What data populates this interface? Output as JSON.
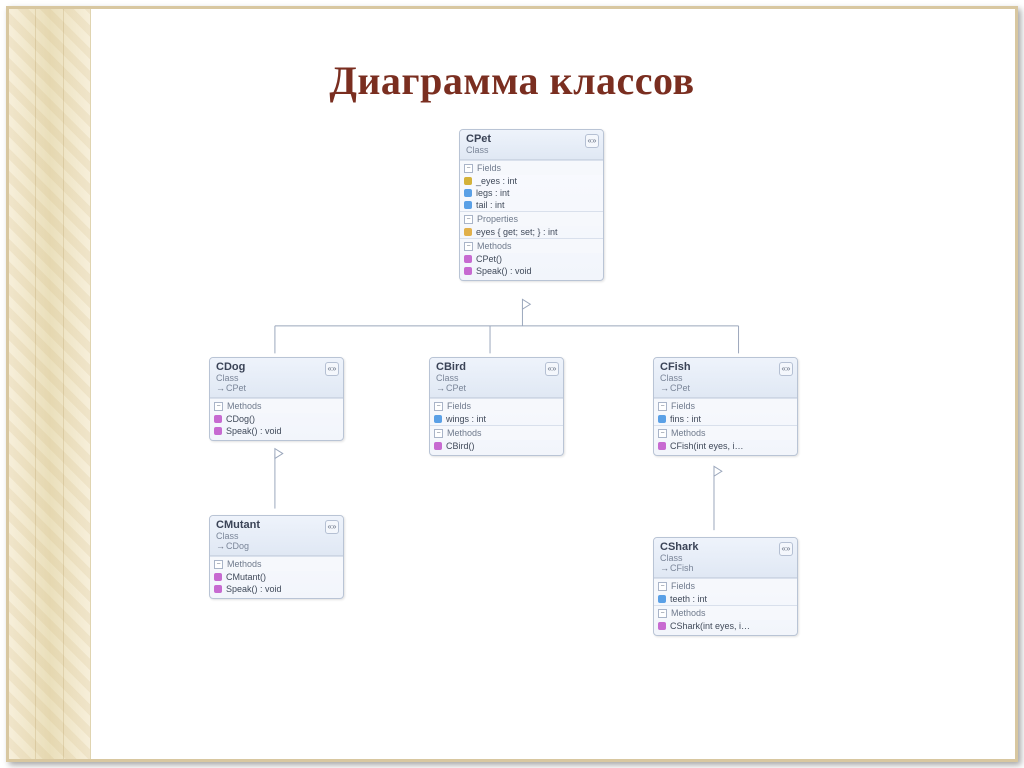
{
  "title": "Диаграмма классов",
  "labels": {
    "class": "Class",
    "fields": "Fields",
    "properties": "Properties",
    "methods": "Methods",
    "chevrons": "«»"
  },
  "classes": {
    "cpet": {
      "name": "CPet",
      "kind": "Class",
      "fields": [
        "_eyes : int",
        "legs : int",
        "tail : int"
      ],
      "properties": [
        "eyes { get; set; } : int"
      ],
      "methods": [
        "CPet()",
        "Speak() : void"
      ]
    },
    "cdog": {
      "name": "CDog",
      "kind": "Class",
      "base": "CPet",
      "methods": [
        "CDog()",
        "Speak() : void"
      ]
    },
    "cbird": {
      "name": "CBird",
      "kind": "Class",
      "base": "CPet",
      "fields": [
        "wings : int"
      ],
      "methods": [
        "CBird()"
      ]
    },
    "cfish": {
      "name": "CFish",
      "kind": "Class",
      "base": "CPet",
      "fields": [
        "fins : int"
      ],
      "methods": [
        "CFish(int eyes, i…"
      ]
    },
    "cmutant": {
      "name": "CMutant",
      "kind": "Class",
      "base": "CDog",
      "methods": [
        "CMutant()",
        "Speak() : void"
      ]
    },
    "cshark": {
      "name": "CShark",
      "kind": "Class",
      "base": "CFish",
      "fields": [
        "teeth : int"
      ],
      "methods": [
        "CShark(int eyes, i…"
      ]
    }
  }
}
